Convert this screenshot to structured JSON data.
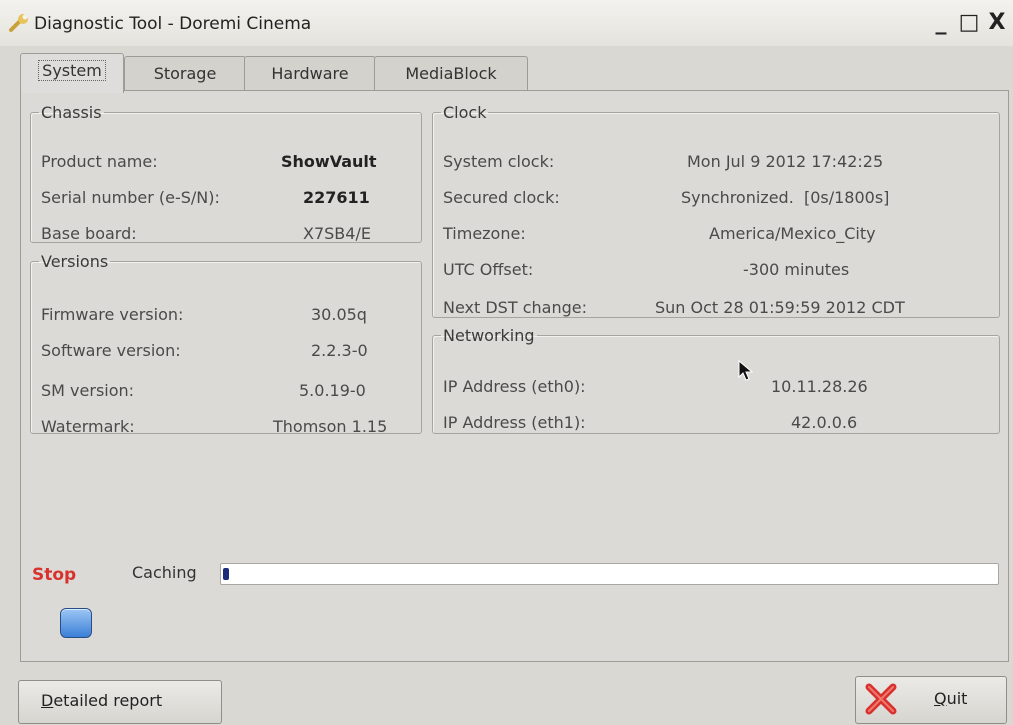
{
  "window": {
    "title": "Diagnostic Tool - Doremi Cinema",
    "minimize": "_",
    "maximize": "□",
    "close": "X"
  },
  "tabs": [
    {
      "label": "System",
      "active": true
    },
    {
      "label": "Storage",
      "active": false
    },
    {
      "label": "Hardware",
      "active": false
    },
    {
      "label": "MediaBlock",
      "active": false
    }
  ],
  "chassis": {
    "title": "Chassis",
    "rows": [
      {
        "label": "Product name:",
        "value": "ShowVault"
      },
      {
        "label": "Serial number (e-S/N):",
        "value": "227611"
      },
      {
        "label": "Base board:",
        "value": "X7SB4/E"
      }
    ]
  },
  "versions": {
    "title": "Versions",
    "rows": [
      {
        "label": "Firmware version:",
        "value": "30.05q"
      },
      {
        "label": "Software version:",
        "value": "2.2.3-0"
      },
      {
        "label": "SM version:",
        "value": "5.0.19-0"
      },
      {
        "label": "Watermark:",
        "value": "Thomson 1.15"
      }
    ]
  },
  "clock": {
    "title": "Clock",
    "rows": [
      {
        "label": "System clock:",
        "value": "Mon Jul 9 2012 17:42:25"
      },
      {
        "label": "Secured clock:",
        "value": "Synchronized.  [0s/1800s]"
      },
      {
        "label": "Timezone:",
        "value": "America/Mexico_City"
      },
      {
        "label": "UTC Offset:",
        "value": "-300 minutes"
      },
      {
        "label": "Next DST change:",
        "value": "Sun Oct 28 01:59:59 2012 CDT"
      }
    ]
  },
  "networking": {
    "title": "Networking",
    "rows": [
      {
        "label": "IP Address (eth0):",
        "value": "10.11.28.26"
      },
      {
        "label": "IP Address (eth1):",
        "value": "42.0.0.6"
      }
    ]
  },
  "status": {
    "stop_label": "Stop",
    "caching_label": "Caching",
    "progress_fraction": 0.005
  },
  "buttons": {
    "detailed_report": "Detailed report",
    "quit": "Quit"
  },
  "colors": {
    "stop_text": "#d8322e",
    "progress_fill": "#1a2c7a",
    "quit_icon": "#d8322e"
  },
  "icons": {
    "app": "wrench-icon",
    "quit": "red-x-icon",
    "indicator": "blue-square-button-icon"
  }
}
